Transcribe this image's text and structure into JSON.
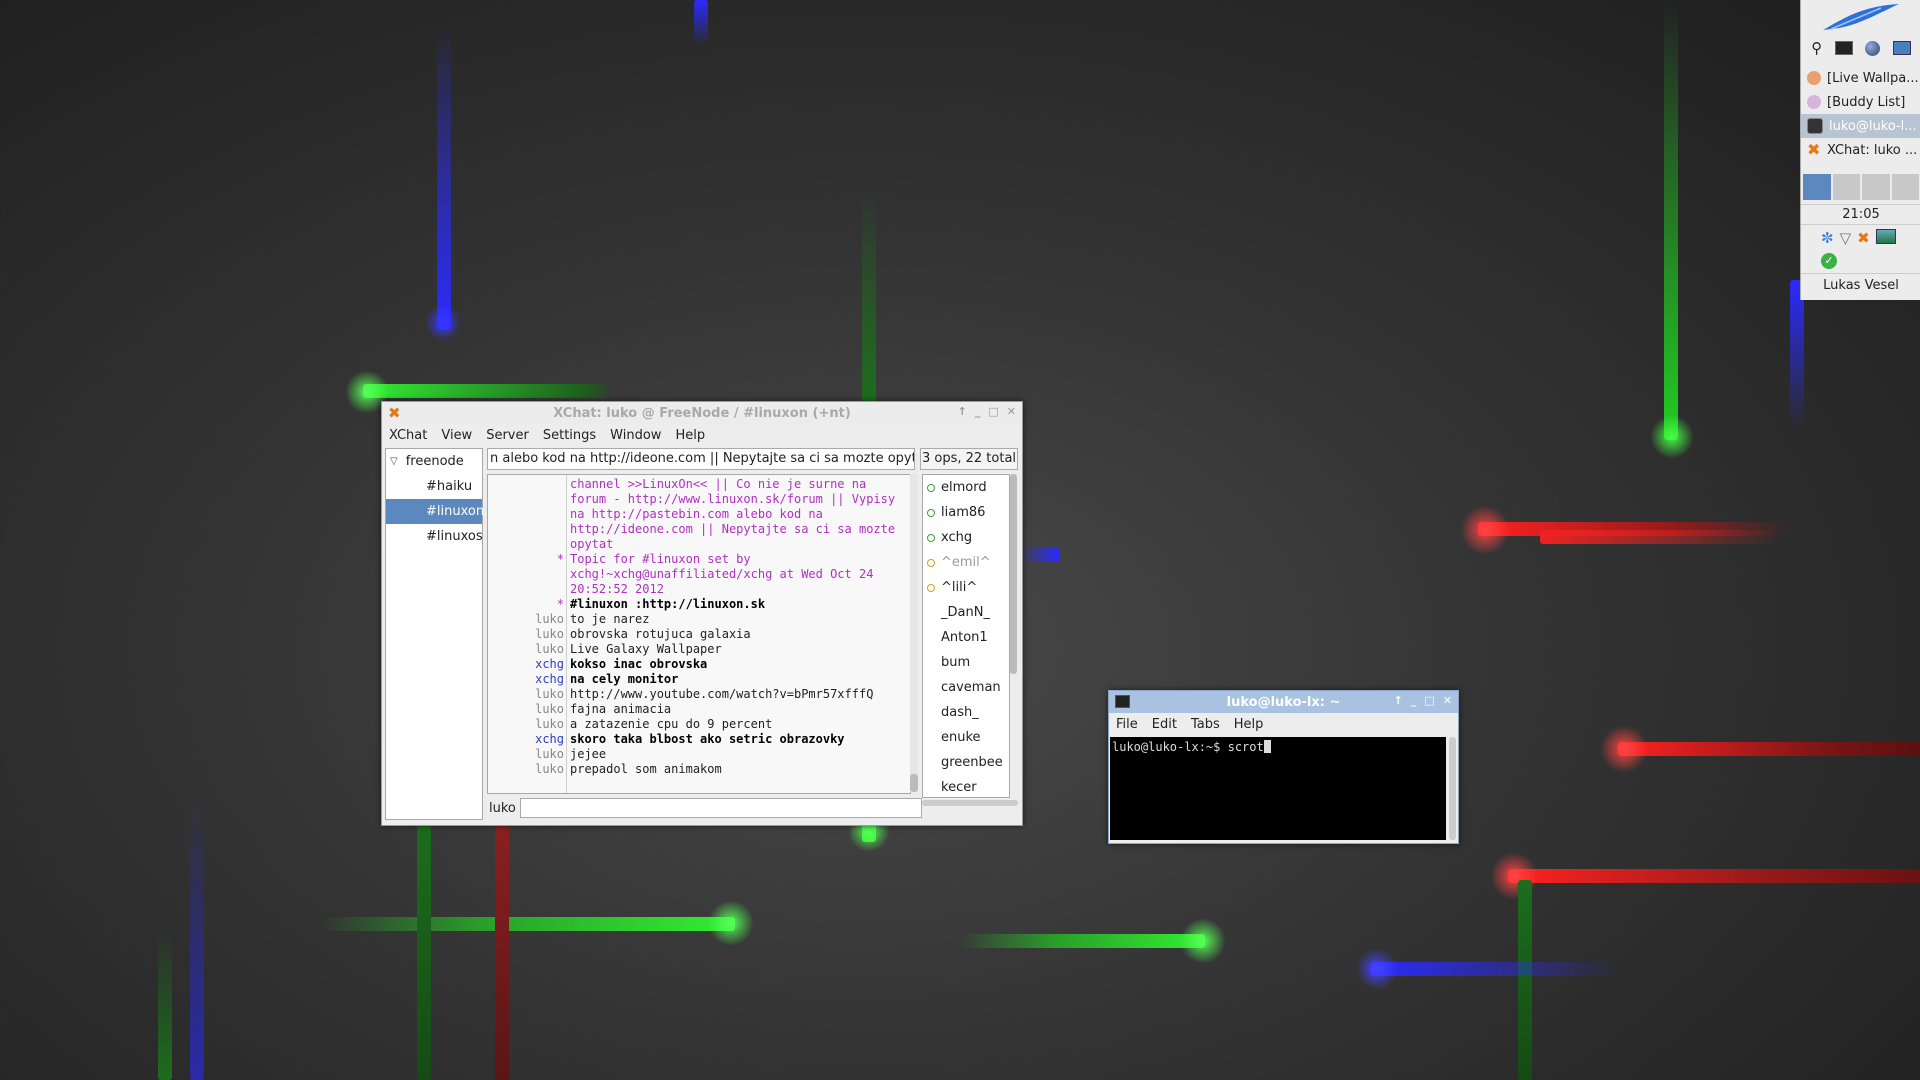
{
  "panel": {
    "clock": "21:05",
    "user_name": "Lukas Vesel",
    "tasks": [
      {
        "label": "[Live Wallpa..."
      },
      {
        "label": "[Buddy List]"
      },
      {
        "label": "luko@luko-l..."
      },
      {
        "label": "XChat: luko ..."
      }
    ],
    "launcher_icons": [
      "search-icon",
      "terminal-icon",
      "browser-icon",
      "desktop-icon"
    ],
    "accent": "#3a7be0"
  },
  "xchat": {
    "title": "XChat: luko @ FreeNode / #linuxon (+nt)",
    "menu": [
      "XChat",
      "View",
      "Server",
      "Settings",
      "Window",
      "Help"
    ],
    "tree": {
      "network": "freenode",
      "channels": [
        "#haiku",
        "#linuxon",
        "#linuxos."
      ]
    },
    "topic": "n alebo kod na http://ideone.com || Nepytajte sa ci sa mozte opytat",
    "user_count": "3 ops, 22 total",
    "messages": [
      {
        "nick": "",
        "text": "channel >>LinuxOn<< || Co nie je surne na",
        "style": "topic"
      },
      {
        "nick": "",
        "text": "forum - http://www.linuxon.sk/forum || Vypisy",
        "style": "topic"
      },
      {
        "nick": "",
        "text": "na http://pastebin.com alebo kod na",
        "style": "topic"
      },
      {
        "nick": "",
        "text": "http://ideone.com || Nepytajte sa ci sa mozte",
        "style": "topic"
      },
      {
        "nick": "",
        "text": "opytat",
        "style": "topic"
      },
      {
        "nick": "*",
        "text": "Topic for #linuxon set by",
        "style": "topic"
      },
      {
        "nick": "",
        "text": "xchg!~xchg@unaffiliated/xchg at Wed Oct 24",
        "style": "topic"
      },
      {
        "nick": "",
        "text": "20:52:52 2012",
        "style": "topic"
      },
      {
        "nick": "*",
        "text": "#linuxon :http://linuxon.sk",
        "style": "bold"
      },
      {
        "nick": "luko",
        "text": "to je narez",
        "style": "normal"
      },
      {
        "nick": "luko",
        "text": "obrovska rotujuca galaxia",
        "style": "normal"
      },
      {
        "nick": "luko",
        "text": "Live Galaxy Wallpaper",
        "style": "normal"
      },
      {
        "nick": "xchg",
        "text": "kokso inac obrovska",
        "style": "bold"
      },
      {
        "nick": "xchg",
        "text": "na cely monitor",
        "style": "bold"
      },
      {
        "nick": "luko",
        "text": "http://www.youtube.com/watch?v=bPmr57xfffQ",
        "style": "normal"
      },
      {
        "nick": "luko",
        "text": "fajna animacia",
        "style": "normal"
      },
      {
        "nick": "luko",
        "text": "a zatazenie cpu do 9 percent",
        "style": "normal"
      },
      {
        "nick": "xchg",
        "text": "skoro taka blbost ako setric obrazovky",
        "style": "bold"
      },
      {
        "nick": "luko",
        "text": "jejee",
        "style": "normal"
      },
      {
        "nick": "luko",
        "text": "prepadol som animakom",
        "style": "normal"
      }
    ],
    "users": [
      {
        "name": "elmord",
        "status": "op"
      },
      {
        "name": "liam86",
        "status": "op"
      },
      {
        "name": "xchg",
        "status": "op"
      },
      {
        "name": "^emil^",
        "status": "away-voice"
      },
      {
        "name": "^lili^",
        "status": "voice"
      },
      {
        "name": "_DanN_",
        "status": ""
      },
      {
        "name": "Anton1",
        "status": ""
      },
      {
        "name": "bum",
        "status": ""
      },
      {
        "name": "caveman",
        "status": ""
      },
      {
        "name": "dash_",
        "status": ""
      },
      {
        "name": "enuke",
        "status": ""
      },
      {
        "name": "greenbee",
        "status": ""
      },
      {
        "name": "kecer",
        "status": ""
      }
    ],
    "input_nick": "luko",
    "input_value": "",
    "colors": {
      "topic": "#b030c0",
      "nick_xchg": "#3040c0",
      "nick_self": "#888888",
      "op_dot": "#3aa03a",
      "voice_dot": "#d0a020"
    }
  },
  "terminal": {
    "title": "luko@luko-lx: ~",
    "menu": [
      "File",
      "Edit",
      "Tabs",
      "Help"
    ],
    "prompt": "luko@luko-lx:~$ ",
    "command": "scrot"
  }
}
